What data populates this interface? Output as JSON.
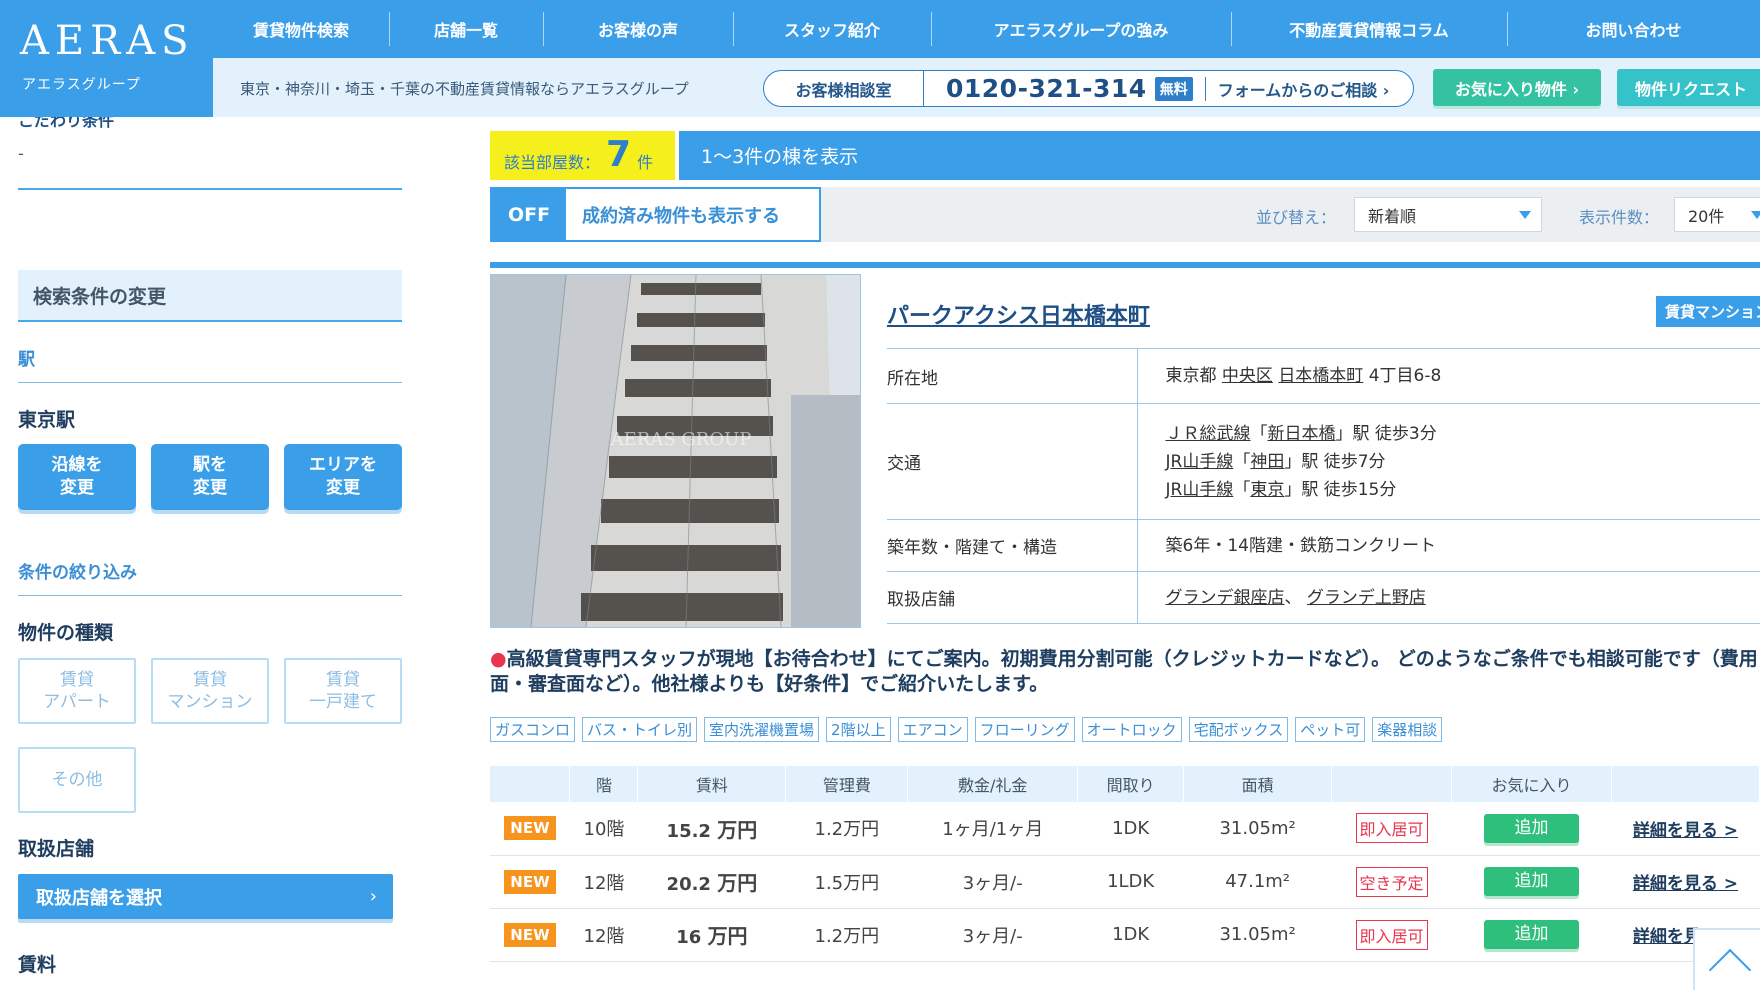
{
  "brand": {
    "logo": "AERAS",
    "sub": "アエラスグループ"
  },
  "nav": [
    "賃貸物件検索",
    "店舗一覧",
    "お客様の声",
    "スタッフ紹介",
    "アエラスグループの強み",
    "不動産賃貸情報コラム",
    "お問い合わせ"
  ],
  "subbar": {
    "tagline": "東京・神奈川・埼玉・千葉の不動産賃貸情報ならアエラスグループ",
    "phone_label": "お客様相談室",
    "phone": "0120-321-314",
    "free": "無料",
    "form_link": "フォームからのご相談 ›",
    "favorites": "お気に入り物件 ›",
    "request": "物件リクエスト"
  },
  "sidebar": {
    "cut_heading": "こだわり条件",
    "dash": "-",
    "cond_heading": "検索条件の変更",
    "station_link": "駅",
    "station_name": "東京駅",
    "change_buttons": [
      "沿線を\n変更",
      "駅を\n変更",
      "エリアを\n変更"
    ],
    "narrow_link": "条件の絞り込み",
    "type_heading": "物件の種類",
    "types": [
      "賃貸\nアパート",
      "賃貸\nマンション",
      "賃貸\n一戸建て",
      "その他"
    ],
    "store_heading": "取扱店舗",
    "store_button": "取扱店舗を選択",
    "store_chevron": "›",
    "rent_heading": "賃料"
  },
  "results": {
    "count_label": "該当部屋数：",
    "count": "7",
    "count_unit": "件",
    "range": "1〜3件の棟を表示",
    "off": "OFF",
    "show_contracted": "成約済み物件も表示する",
    "sort_label": "並び替え：",
    "sort_value": "新着順",
    "per_page_label": "表示件数：",
    "per_page_value": "20件"
  },
  "property": {
    "name": "パークアクシス日本橋本町",
    "type": "賃貸マンション",
    "watermark": "AERAS GROUP",
    "labels": {
      "address": "所在地",
      "access": "交通",
      "build": "築年数・階建て・構造",
      "stores": "取扱店舗"
    },
    "address": {
      "pref": "東京都",
      "ward": "中央区",
      "town": "日本橋本町",
      "rest": "4丁目6-8"
    },
    "access": [
      {
        "line": "ＪＲ総武線",
        "station": "新日本橋",
        "walk": "徒歩3分"
      },
      {
        "line": "JR山手線",
        "station": "神田",
        "walk": "徒歩7分"
      },
      {
        "line": "JR山手線",
        "station": "東京",
        "walk": "徒歩15分"
      }
    ],
    "build": "築6年・14階建・鉄筋コンクリート",
    "stores": [
      "グランデ銀座店",
      "グランデ上野店"
    ],
    "notice_dot": "●",
    "notice": "高級賃貸専門スタッフが現地【お待合わせ】にてご案内。初期費用分割可能（クレジットカードなど）。 どのようなご条件でも相談可能です（費用面・審査面など）。他社様よりも【好条件】でご紹介いたします。",
    "features": [
      "ガスコンロ",
      "バス・トイレ別",
      "室内洗濯機置場",
      "2階以上",
      "エアコン",
      "フローリング",
      "オートロック",
      "宅配ボックス",
      "ペット可",
      "楽器相談"
    ]
  },
  "room_table": {
    "headers": [
      "",
      "階",
      "賃料",
      "管理費",
      "敷金/礼金",
      "間取り",
      "面積",
      "",
      "お気に入り",
      ""
    ],
    "rows": [
      {
        "badge": "NEW",
        "floor": "10階",
        "rent": "15.2",
        "rent_unit": "万円",
        "fee": "1.2万円",
        "deposit": "1ヶ月/1ヶ月",
        "layout": "1DK",
        "area": "31.05m²",
        "status": "即入居可",
        "fav": "追加",
        "detail": "詳細を見る >"
      },
      {
        "badge": "NEW",
        "floor": "12階",
        "rent": "20.2",
        "rent_unit": "万円",
        "fee": "1.5万円",
        "deposit": "3ヶ月/-",
        "layout": "1LDK",
        "area": "47.1m²",
        "status": "空き予定",
        "fav": "追加",
        "detail": "詳細を見る >"
      },
      {
        "badge": "NEW",
        "floor": "12階",
        "rent": "16",
        "rent_unit": "万円",
        "fee": "1.2万円",
        "deposit": "3ヶ月/-",
        "layout": "1DK",
        "area": "31.05m²",
        "status": "即入居可",
        "fav": "追加",
        "detail": "詳細を見る >"
      }
    ]
  },
  "colors": {
    "brand_blue": "#3a9ee8",
    "highlight_yellow": "#f5ef1c",
    "rent_orange": "#f7941d",
    "status_red": "#e8364f",
    "add_green": "#2fbf7c"
  },
  "icons": {
    "scroll_top": "chevron-up-icon",
    "caret": "caret-down-icon"
  }
}
